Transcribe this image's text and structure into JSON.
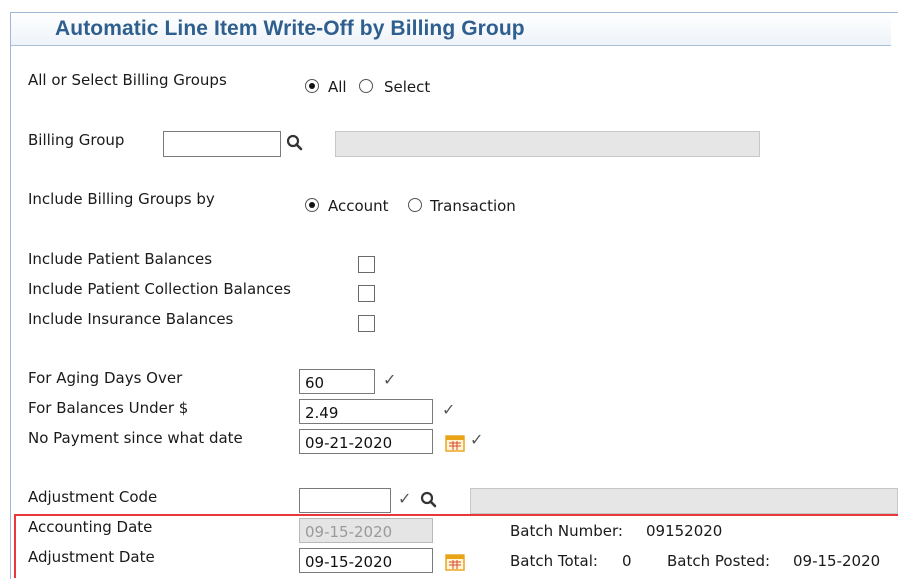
{
  "title": "Automatic Line Item Write-Off by Billing Group",
  "billing_groups_choice": {
    "label": "All or Select Billing Groups",
    "options": [
      "All",
      "Select"
    ],
    "selected": "All"
  },
  "billing_group": {
    "label": "Billing Group",
    "value": "",
    "description": ""
  },
  "include_by": {
    "label": "Include Billing Groups by",
    "options": [
      "Account",
      "Transaction"
    ],
    "selected": "Account"
  },
  "balances": [
    {
      "label": "Include Patient Balances",
      "checked": false
    },
    {
      "label": "Include Patient Collection Balances",
      "checked": false
    },
    {
      "label": "Include Insurance Balances",
      "checked": false
    }
  ],
  "aging": {
    "label": "For Aging Days Over",
    "value": "60"
  },
  "balance_under": {
    "label": "For Balances Under $",
    "value": "2.49"
  },
  "no_payment": {
    "label": "No Payment since what date",
    "value": "09-21-2020"
  },
  "adjustment_code": {
    "label": "Adjustment Code",
    "value": "",
    "description": ""
  },
  "accounting_date": {
    "label": "Accounting Date",
    "value": "09-15-2020"
  },
  "adjustment_date": {
    "label": "Adjustment Date",
    "value": "09-15-2020"
  },
  "batch": {
    "number_label": "Batch Number:",
    "number": "09152020",
    "total_label": "Batch Total:",
    "total": "0",
    "posted_label": "Batch Posted:",
    "posted": "09-15-2020"
  },
  "icons": {
    "search": "search-icon",
    "calendar": "calendar-icon",
    "validate": "checkmark-icon"
  },
  "colors": {
    "title": "#2e5f8f",
    "highlight": "#e8383d",
    "calendar": "#e8a317"
  }
}
